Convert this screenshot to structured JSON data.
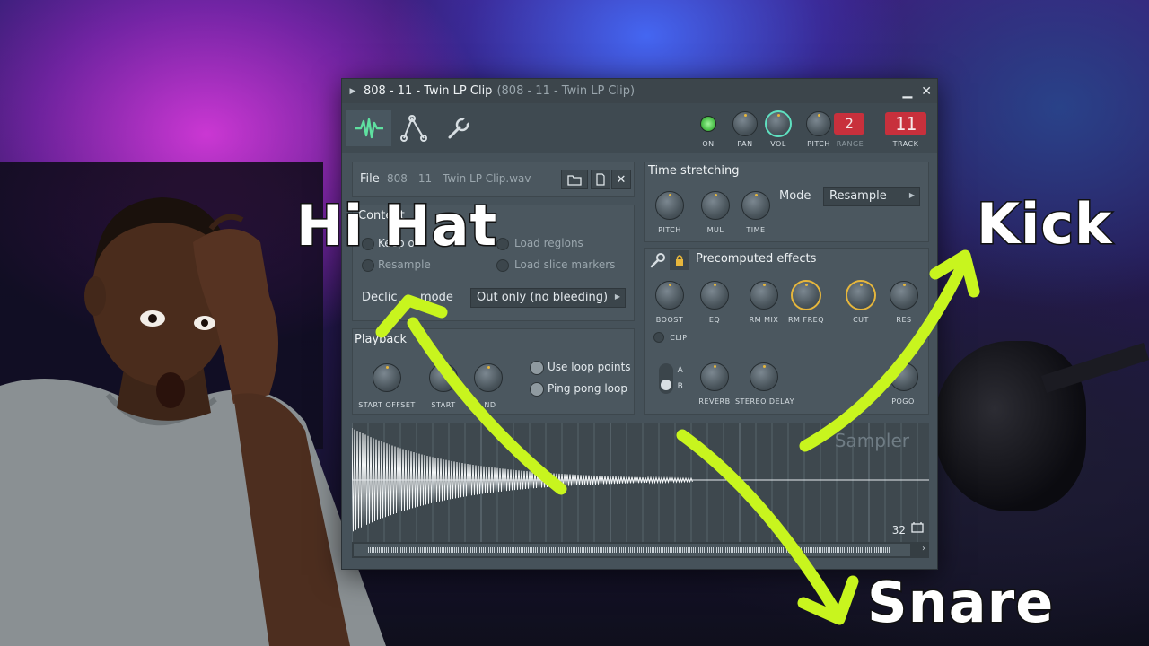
{
  "window": {
    "title_main": "808 - 11 - Twin LP Clip",
    "title_sub": "(808 - 11 - Twin LP Clip)",
    "minimize": "▁",
    "close": "✕"
  },
  "toolbar": {
    "on_label": "ON",
    "pan_label": "PAN",
    "vol_label": "VOL",
    "pitch_label": "PITCH",
    "range_label": "RANGE",
    "range_value": "2",
    "track_label": "TRACK",
    "track_value": "11"
  },
  "file": {
    "label": "File",
    "filename": "808 - 11 - Twin LP Clip.wav"
  },
  "content": {
    "title": "Content",
    "keep_label": "Keep o",
    "load_regions": "Load regions",
    "resample": "Resample",
    "load_slice_markers": "Load slice markers",
    "declick_label": "Declic",
    "mode_label": "mode",
    "declick_value": "Out only (no bleeding)"
  },
  "time_stretching": {
    "title": "Time stretching",
    "mode_label": "Mode",
    "mode_value": "Resample",
    "knobs": [
      "PITCH",
      "MUL",
      "TIME"
    ]
  },
  "precomputed": {
    "title": "Precomputed effects",
    "knobs": [
      "BOOST",
      "EQ",
      "RM MIX",
      "RM FREQ",
      "CUT",
      "RES"
    ],
    "clip_label": "CLIP",
    "ab_a": "A",
    "ab_b": "B",
    "reverb_label": "REVERB",
    "stereo_delay_label": "STEREO DELAY",
    "pogo_label": "POGO"
  },
  "playback": {
    "title": "Playback",
    "start_offset": "START OFFSET",
    "start": "START",
    "end_partial": "ND",
    "use_loop_points": "Use loop points",
    "ping_pong_loop": "Ping pong loop"
  },
  "waveform": {
    "watermark": "Sampler",
    "zoom_value": "32"
  },
  "annotations": {
    "hi_hat": "Hi Hat",
    "kick": "Kick",
    "snare": "Snare"
  },
  "colors": {
    "arrow": "#c8f51e",
    "knob_accent": "#e6b63c",
    "on_led": "#7fe07a",
    "vol_ring": "#5fe0c0",
    "track_red": "#c8303c"
  }
}
